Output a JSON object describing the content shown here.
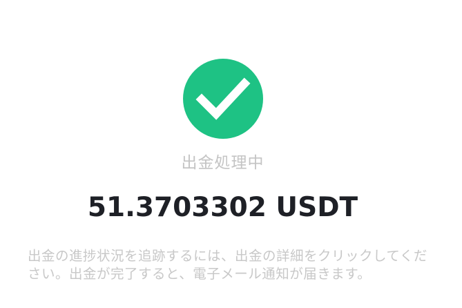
{
  "status": {
    "icon": "check-circle-icon",
    "color": "#1ec284",
    "text": "出金処理中"
  },
  "amount": {
    "value": "51.3703302",
    "currency": "USDT",
    "display": "51.3703302 USDT"
  },
  "info": {
    "text": "出金の進捗状況を追跡するには、出金の詳細をクリックしてください。出金が完了すると、電子メール通知が届きます。"
  }
}
